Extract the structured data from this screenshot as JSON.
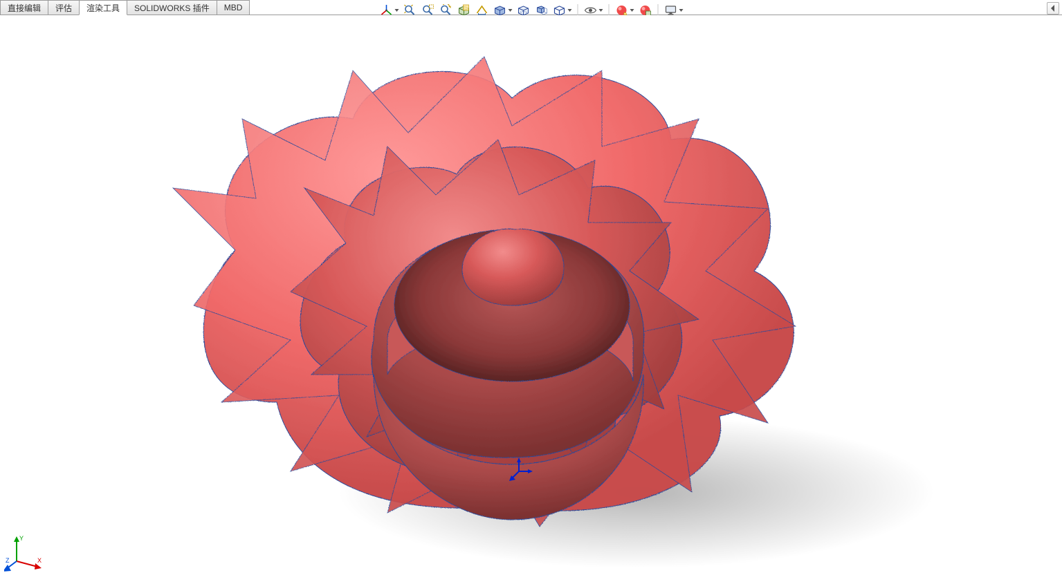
{
  "tabs": [
    {
      "id": "direct-edit",
      "label": "直接编辑",
      "active": false
    },
    {
      "id": "evaluate",
      "label": "评估",
      "active": false
    },
    {
      "id": "render-tools",
      "label": "渲染工具",
      "active": true
    },
    {
      "id": "solidworks-addins",
      "label": "SOLIDWORKS 插件",
      "active": false
    },
    {
      "id": "mbd",
      "label": "MBD",
      "active": false
    }
  ],
  "heads_up_toolbar": [
    {
      "id": "orient",
      "icon": "triad-icon",
      "dropdown": true
    },
    {
      "id": "zoom-fit",
      "icon": "zoom-fit-icon",
      "dropdown": false
    },
    {
      "id": "zoom-area",
      "icon": "zoom-area-icon",
      "dropdown": false
    },
    {
      "id": "previous-view",
      "icon": "prev-view-icon",
      "dropdown": false
    },
    {
      "id": "section",
      "icon": "section-view-icon",
      "dropdown": false
    },
    {
      "id": "dynamic-annotation",
      "icon": "dynamic-annotation-icon",
      "dropdown": false
    },
    {
      "id": "display-style",
      "icon": "display-style-icon",
      "dropdown": true
    },
    {
      "id": "hidden-lines",
      "icon": "hidden-lines-icon",
      "dropdown": false
    },
    {
      "id": "perspective",
      "icon": "perspective-icon",
      "dropdown": false
    },
    {
      "id": "view-cube",
      "icon": "view-cube-icon",
      "dropdown": true
    },
    {
      "id": "sep1",
      "separator": true
    },
    {
      "id": "hide-show",
      "icon": "eye-icon",
      "dropdown": true
    },
    {
      "id": "sep2",
      "separator": true
    },
    {
      "id": "appearance",
      "icon": "appearance-icon",
      "dropdown": true
    },
    {
      "id": "scene",
      "icon": "scene-icon",
      "dropdown": false
    },
    {
      "id": "sep3",
      "separator": true
    },
    {
      "id": "view-settings",
      "icon": "monitor-icon",
      "dropdown": true
    }
  ],
  "triad_axes": {
    "x": "X",
    "y": "Y",
    "z": "Z"
  },
  "model": {
    "description": "red rose flower 3D model",
    "material_color": "#c84a4a",
    "highlight_color": "#f07070",
    "edge_color": "#2b4a9a",
    "shadow_color": "#b8b8b8"
  }
}
